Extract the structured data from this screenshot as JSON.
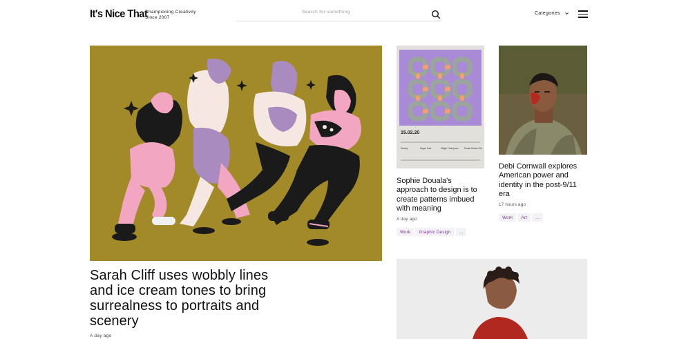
{
  "header": {
    "logo": "It's Nice That",
    "tagline_line1": "Championing Creativity",
    "tagline_line2": "Since 2007",
    "search_placeholder": "Search for something",
    "categories_label": "Categories"
  },
  "feature": {
    "title": "Sarah Cliff uses wobbly lines and ice cream tones to bring surrealness to portraits and scenery",
    "time": "A day ago"
  },
  "cards": [
    {
      "title": "Sophie Douala's approach to design is to create patterns imbued with meaning",
      "time": "A day ago",
      "tags": [
        "Work",
        "Graphic Design",
        "..."
      ],
      "poster": {
        "date": "15.02.20",
        "lineup": [
          "Sweely",
          "Sugar Free",
          "Midge Thompson",
          "Social House Orb"
        ]
      }
    },
    {
      "title": "Debi Cornwall explores American power and identity in the post-9/11 era",
      "time": "17 hours ago",
      "tags": [
        "Work",
        "Art",
        "..."
      ]
    }
  ],
  "colors": {
    "feature_bg": "#a28a28",
    "tag_text": "#7a2fa0",
    "tag_bg": "#f4f2f6"
  }
}
